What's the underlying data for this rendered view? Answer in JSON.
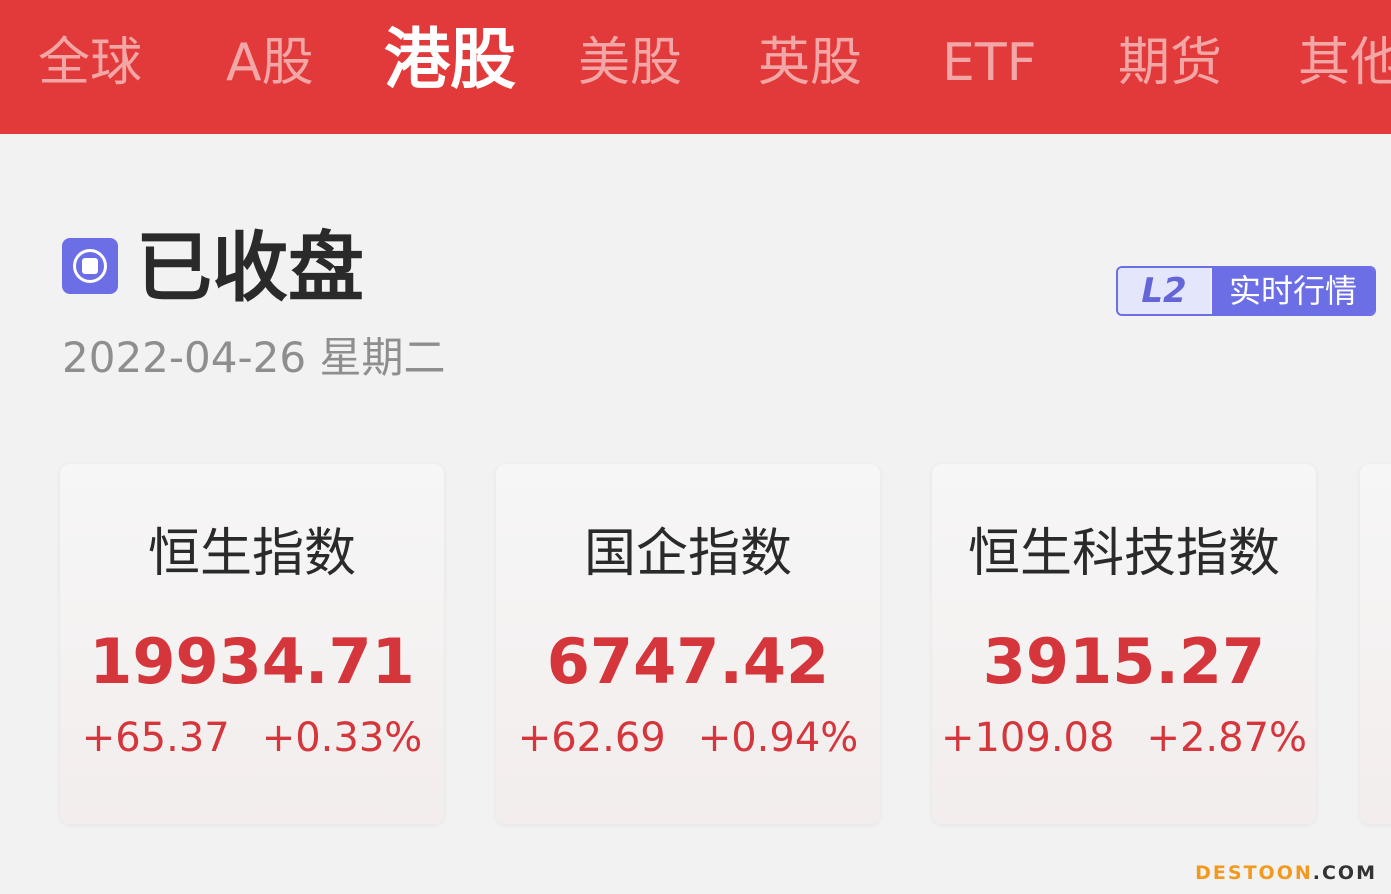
{
  "tabs": [
    {
      "label": "全球",
      "active": false
    },
    {
      "label": "A股",
      "active": false
    },
    {
      "label": "港股",
      "active": true
    },
    {
      "label": "美股",
      "active": false
    },
    {
      "label": "英股",
      "active": false
    },
    {
      "label": "ETF",
      "active": false
    },
    {
      "label": "期货",
      "active": false
    },
    {
      "label": "其他",
      "active": false
    }
  ],
  "status": {
    "title": "已收盘",
    "date": "2022-04-26",
    "weekday": "星期二",
    "icon": "market-status-icon"
  },
  "l2_badge": {
    "tag": "L2",
    "text": "实时行情"
  },
  "indices": [
    {
      "name": "恒生指数",
      "price": "19934.71",
      "change": "+65.37",
      "change_pct": "+0.33%"
    },
    {
      "name": "国企指数",
      "price": "6747.42",
      "change": "+62.69",
      "change_pct": "+0.94%"
    },
    {
      "name": "恒生科技指数",
      "price": "3915.27",
      "change": "+109.08",
      "change_pct": "+2.87%"
    }
  ],
  "watermark": {
    "part1": "DESTOON",
    "part2": ".COM"
  },
  "colors": {
    "header_red": "#e23a3a",
    "up_red": "#d4363c",
    "accent_purple": "#6c6ee6"
  }
}
